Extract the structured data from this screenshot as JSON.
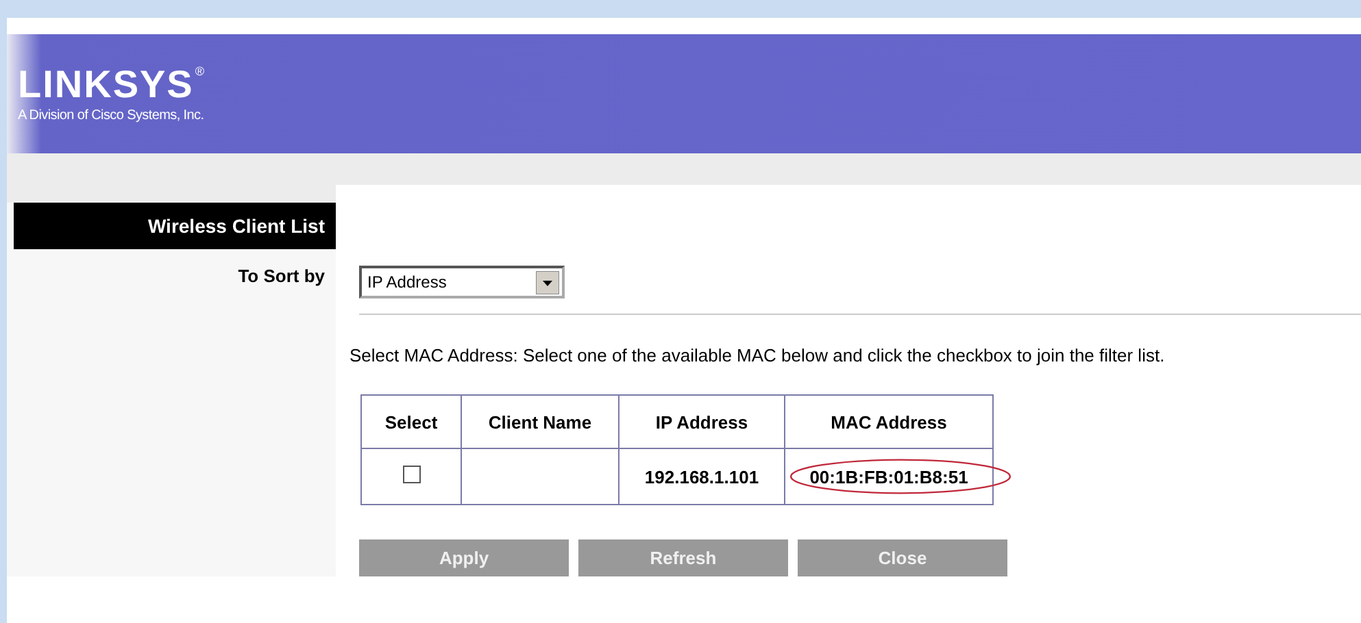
{
  "header": {
    "logo": "LINKSYS",
    "registered_mark": "®",
    "tagline": "A Division of Cisco Systems, Inc."
  },
  "section_title": "Wireless Client List",
  "sort": {
    "label": "To Sort by",
    "value": "IP Address"
  },
  "instructions": "Select MAC Address: Select one of the available MAC below and click the checkbox to join the filter list.",
  "table": {
    "columns": [
      "Select",
      "Client Name",
      "IP Address",
      "MAC Address"
    ],
    "rows": [
      {
        "checked": false,
        "client_name": "",
        "ip_address": "192.168.1.101",
        "mac_address": "00:1B:FB:01:B8:51",
        "highlighted": true
      }
    ]
  },
  "buttons": [
    "Apply",
    "Refresh",
    "Close"
  ]
}
